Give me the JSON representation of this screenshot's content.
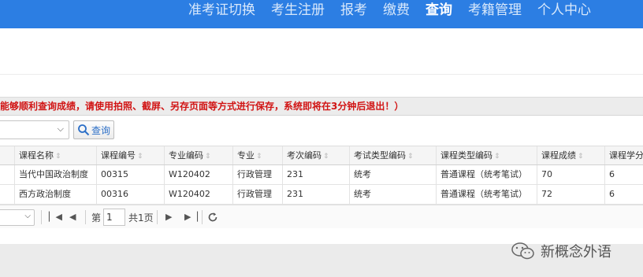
{
  "top_nav": {
    "items": [
      {
        "label": "准考证切换",
        "active": false
      },
      {
        "label": "考生注册",
        "active": false
      },
      {
        "label": "报考",
        "active": false
      },
      {
        "label": "缴费",
        "active": false
      },
      {
        "label": "查询",
        "active": true
      },
      {
        "label": "考籍管理",
        "active": false
      },
      {
        "label": "个人中心",
        "active": false
      }
    ]
  },
  "notice": {
    "text": "能够顺利查询成绩，请使用拍照、截屏、另存页面等方式进行保存，系统即将在3分钟后退出！）",
    "color": "#d11414"
  },
  "toolbar": {
    "select_value": "",
    "query_label": "查询"
  },
  "grid": {
    "columns": [
      "课程名称",
      "课程编号",
      "专业编码",
      "专业",
      "考次编码",
      "考试类型编码",
      "课程类型编码",
      "课程成绩",
      "课程学分"
    ],
    "rows": [
      [
        "当代中国政治制度",
        "00315",
        "W120402",
        "行政管理",
        "231",
        "统考",
        "普通课程（统考笔试）",
        "70",
        "6"
      ],
      [
        "西方政治制度",
        "00316",
        "W120402",
        "行政管理",
        "231",
        "统考",
        "普通课程（统考笔试）",
        "72",
        "6"
      ]
    ]
  },
  "pager": {
    "page_prefix": "第",
    "page_value": "1",
    "page_suffix": "共1页"
  },
  "watermark": {
    "text": "新概念外语"
  },
  "colors": {
    "accent": "#2c7ee3",
    "alert": "#d11414"
  }
}
